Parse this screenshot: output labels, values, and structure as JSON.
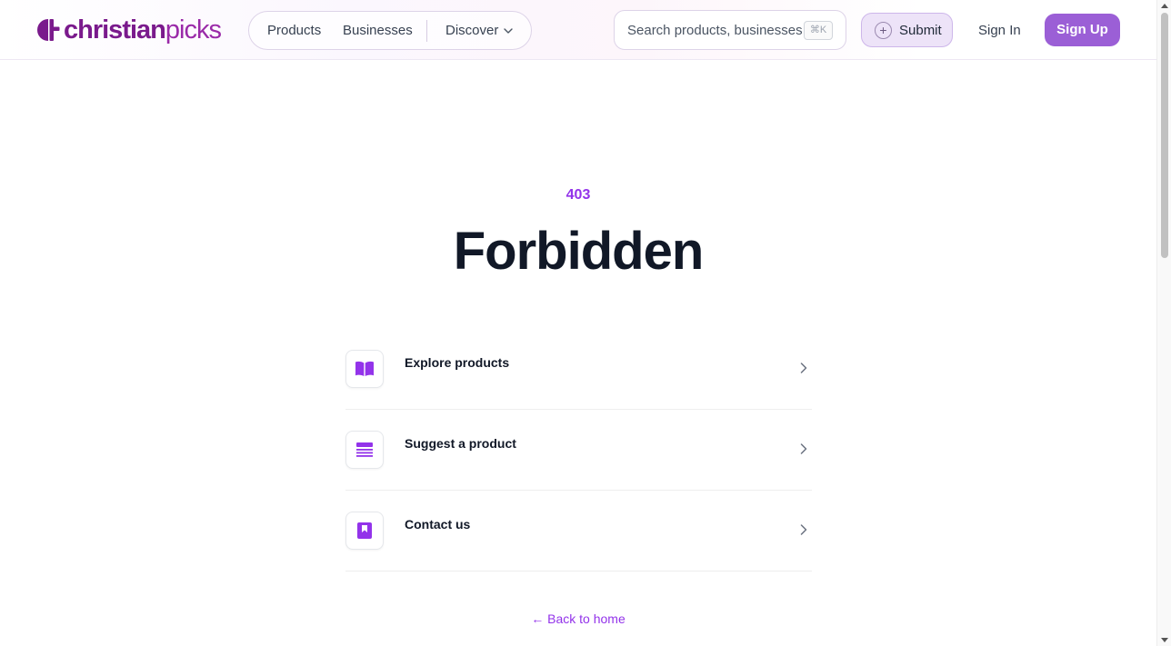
{
  "colors": {
    "accent": "#9333ea",
    "brand": "#7a1a8c",
    "signup_bg": "#9b5fd6"
  },
  "header": {
    "logo": {
      "part1": "christian",
      "part2": "picks"
    },
    "nav": {
      "products": "Products",
      "businesses": "Businesses",
      "discover": "Discover"
    },
    "search": {
      "placeholder": "Search products, businesses...",
      "shortcut": "⌘K"
    },
    "submit_label": "Submit",
    "signin_label": "Sign In",
    "signup_label": "Sign Up"
  },
  "main": {
    "code": "403",
    "title": "Forbidden",
    "links": [
      {
        "label": "Explore products",
        "icon": "book-open-icon"
      },
      {
        "label": "Suggest a product",
        "icon": "list-icon"
      },
      {
        "label": "Contact us",
        "icon": "bookmark-icon"
      }
    ],
    "back_label": "← Back to home"
  }
}
